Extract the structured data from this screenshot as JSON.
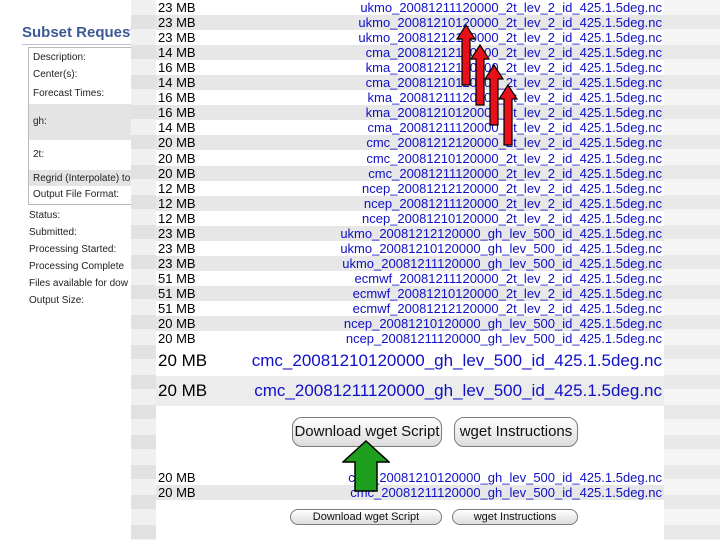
{
  "background_page": {
    "title": "Subset Request I",
    "details_labels": [
      "Description:",
      "Center(s):",
      "Forecast Times:",
      "gh:",
      "2t:",
      "Regrid (Interpolate) to",
      "Output File Format:"
    ],
    "status_labels": [
      "Status:",
      "Submitted:",
      "Processing Started:",
      "Processing Complete",
      "Files available for dow",
      "Output Size:"
    ]
  },
  "files": [
    {
      "size": "23 MB",
      "name": "ukmo_20081211120000_2t_lev_2_id_425.1.5deg.nc"
    },
    {
      "size": "23 MB",
      "name": "ukmo_20081210120000_2t_lev_2_id_425.1.5deg.nc"
    },
    {
      "size": "23 MB",
      "name": "ukmo_20081212120000_2t_lev_2_id_425.1.5deg.nc"
    },
    {
      "size": "14 MB",
      "name": "cma_20081212120000_2t_lev_2_id_425.1.5deg.nc"
    },
    {
      "size": "16 MB",
      "name": "kma_20081212120000_2t_lev_2_id_425.1.5deg.nc"
    },
    {
      "size": "14 MB",
      "name": "cma_20081210120000_2t_lev_2_id_425.1.5deg.nc"
    },
    {
      "size": "16 MB",
      "name": "kma_20081211120000_2t_lev_2_id_425.1.5deg.nc"
    },
    {
      "size": "16 MB",
      "name": "kma_20081210120000_2t_lev_2_id_425.1.5deg.nc"
    },
    {
      "size": "14 MB",
      "name": "cma_20081211120000_2t_lev_2_id_425.1.5deg.nc"
    },
    {
      "size": "20 MB",
      "name": "cmc_20081212120000_2t_lev_2_id_425.1.5deg.nc"
    },
    {
      "size": "20 MB",
      "name": "cmc_20081210120000_2t_lev_2_id_425.1.5deg.nc"
    },
    {
      "size": "20 MB",
      "name": "cmc_20081211120000_2t_lev_2_id_425.1.5deg.nc"
    },
    {
      "size": "12 MB",
      "name": "ncep_20081212120000_2t_lev_2_id_425.1.5deg.nc"
    },
    {
      "size": "12 MB",
      "name": "ncep_20081211120000_2t_lev_2_id_425.1.5deg.nc"
    },
    {
      "size": "12 MB",
      "name": "ncep_20081210120000_2t_lev_2_id_425.1.5deg.nc"
    },
    {
      "size": "23 MB",
      "name": "ukmo_20081212120000_gh_lev_500_id_425.1.5deg.nc"
    },
    {
      "size": "23 MB",
      "name": "ukmo_20081210120000_gh_lev_500_id_425.1.5deg.nc"
    },
    {
      "size": "23 MB",
      "name": "ukmo_20081211120000_gh_lev_500_id_425.1.5deg.nc"
    },
    {
      "size": "51 MB",
      "name": "ecmwf_20081211120000_2t_lev_2_id_425.1.5deg.nc"
    },
    {
      "size": "51 MB",
      "name": "ecmwf_20081210120000_2t_lev_2_id_425.1.5deg.nc"
    },
    {
      "size": "51 MB",
      "name": "ecmwf_20081212120000_2t_lev_2_id_425.1.5deg.nc"
    },
    {
      "size": "20 MB",
      "name": "ncep_20081210120000_gh_lev_500_id_425.1.5deg.nc"
    },
    {
      "size": "20 MB",
      "name": "ncep_20081211120000_gh_lev_500_id_425.1.5deg.nc"
    }
  ],
  "zoomed_files": [
    {
      "size": "20 MB",
      "name": "cmc_20081210120000_gh_lev_500_id_425.1.5deg.nc"
    },
    {
      "size": "20 MB",
      "name": "cmc_20081211120000_gh_lev_500_id_425.1.5deg.nc"
    }
  ],
  "buttons": {
    "download_wget": "Download wget Script",
    "wget_instructions": "wget Instructions"
  },
  "bottom_files": [
    {
      "size": "20 MB",
      "name": "cmc_20081210120000_gh_lev_500_id_425.1.5deg.nc"
    },
    {
      "size": "20 MB",
      "name": "cmc_20081211120000_gh_lev_500_id_425.1.5deg.nc"
    }
  ],
  "colors": {
    "link": "#1010c8",
    "title": "#3d5a96",
    "red_arrow": "#e8101a",
    "green_arrow": "#1ea01e"
  }
}
